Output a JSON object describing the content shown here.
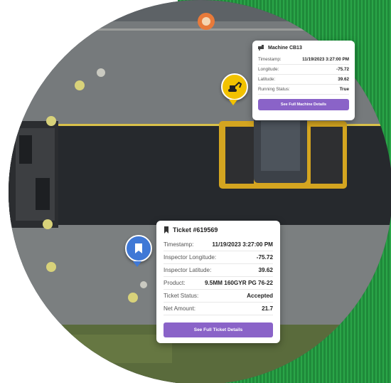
{
  "colors": {
    "accent_button": "#8a63c8",
    "machine_pin": "#f2c200",
    "ticket_pin": "#3f78d6",
    "green_panel": "#1f8a3a"
  },
  "machine_card": {
    "icon": "roller-icon",
    "title": "Machine CB13",
    "rows": [
      {
        "label": "Timestamp:",
        "value": "11/19/2023  3:27:00 PM"
      },
      {
        "label": "Longitude:",
        "value": "-75.72"
      },
      {
        "label": "Latitude:",
        "value": "39.62"
      },
      {
        "label": "Running Status:",
        "value": "True"
      }
    ],
    "button_label": "See Full Machine Details"
  },
  "ticket_card": {
    "icon": "bookmark-icon",
    "title": "Ticket #619569",
    "rows": [
      {
        "label": "Timestamp:",
        "value": "11/19/2023  3:27:00 PM"
      },
      {
        "label": "Inspector Longitude:",
        "value": "-75.72"
      },
      {
        "label": "Inspector Latitude:",
        "value": "39.62"
      },
      {
        "label": "Product:",
        "value": "9.5MM 160GYR PG 76-22"
      },
      {
        "label": "Ticket Status:",
        "value": "Accepted"
      },
      {
        "label": "Net Amount:",
        "value": "21.7"
      }
    ],
    "button_label": "See Full Ticket Details"
  },
  "map_pins": {
    "machine_pin_icon": "excavator-icon",
    "ticket_pin_icon": "bookmark-icon"
  }
}
